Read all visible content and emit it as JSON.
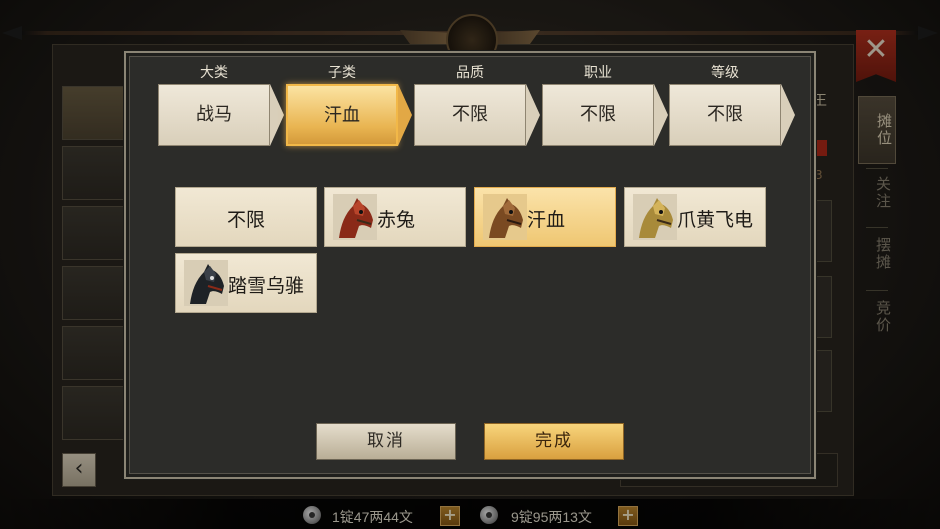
{
  "background": {
    "tabs": [
      "摊位",
      "关注",
      "摆摊",
      "竞价"
    ],
    "peek_text": "王",
    "peek_num": "3"
  },
  "filters": [
    {
      "label": "大类",
      "value": "战马",
      "active": false
    },
    {
      "label": "子类",
      "value": "汗血",
      "active": true
    },
    {
      "label": "品质",
      "value": "不限",
      "active": false
    },
    {
      "label": "职业",
      "value": "不限",
      "active": false
    },
    {
      "label": "等级",
      "value": "不限",
      "active": false
    }
  ],
  "options": [
    {
      "label": "不限",
      "icon": null,
      "selected": false
    },
    {
      "label": "赤兔",
      "icon": "red-horse-icon",
      "selected": false
    },
    {
      "label": "汗血",
      "icon": "brown-horse-icon",
      "selected": true
    },
    {
      "label": "爪黄飞电",
      "icon": "golden-horse-icon",
      "selected": false
    },
    {
      "label": "踏雪乌骓",
      "icon": "black-horse-icon",
      "selected": false
    }
  ],
  "actions": {
    "cancel": "取消",
    "confirm": "完成"
  },
  "currency": {
    "silver": "1锭47两44文",
    "bound_silver": "9锭95两13文"
  },
  "colors": {
    "accent_gold": "#efc772",
    "modal_bg": "#2c2c29",
    "option_bg": "#f1e8d4",
    "close_red": "#b8321f"
  }
}
